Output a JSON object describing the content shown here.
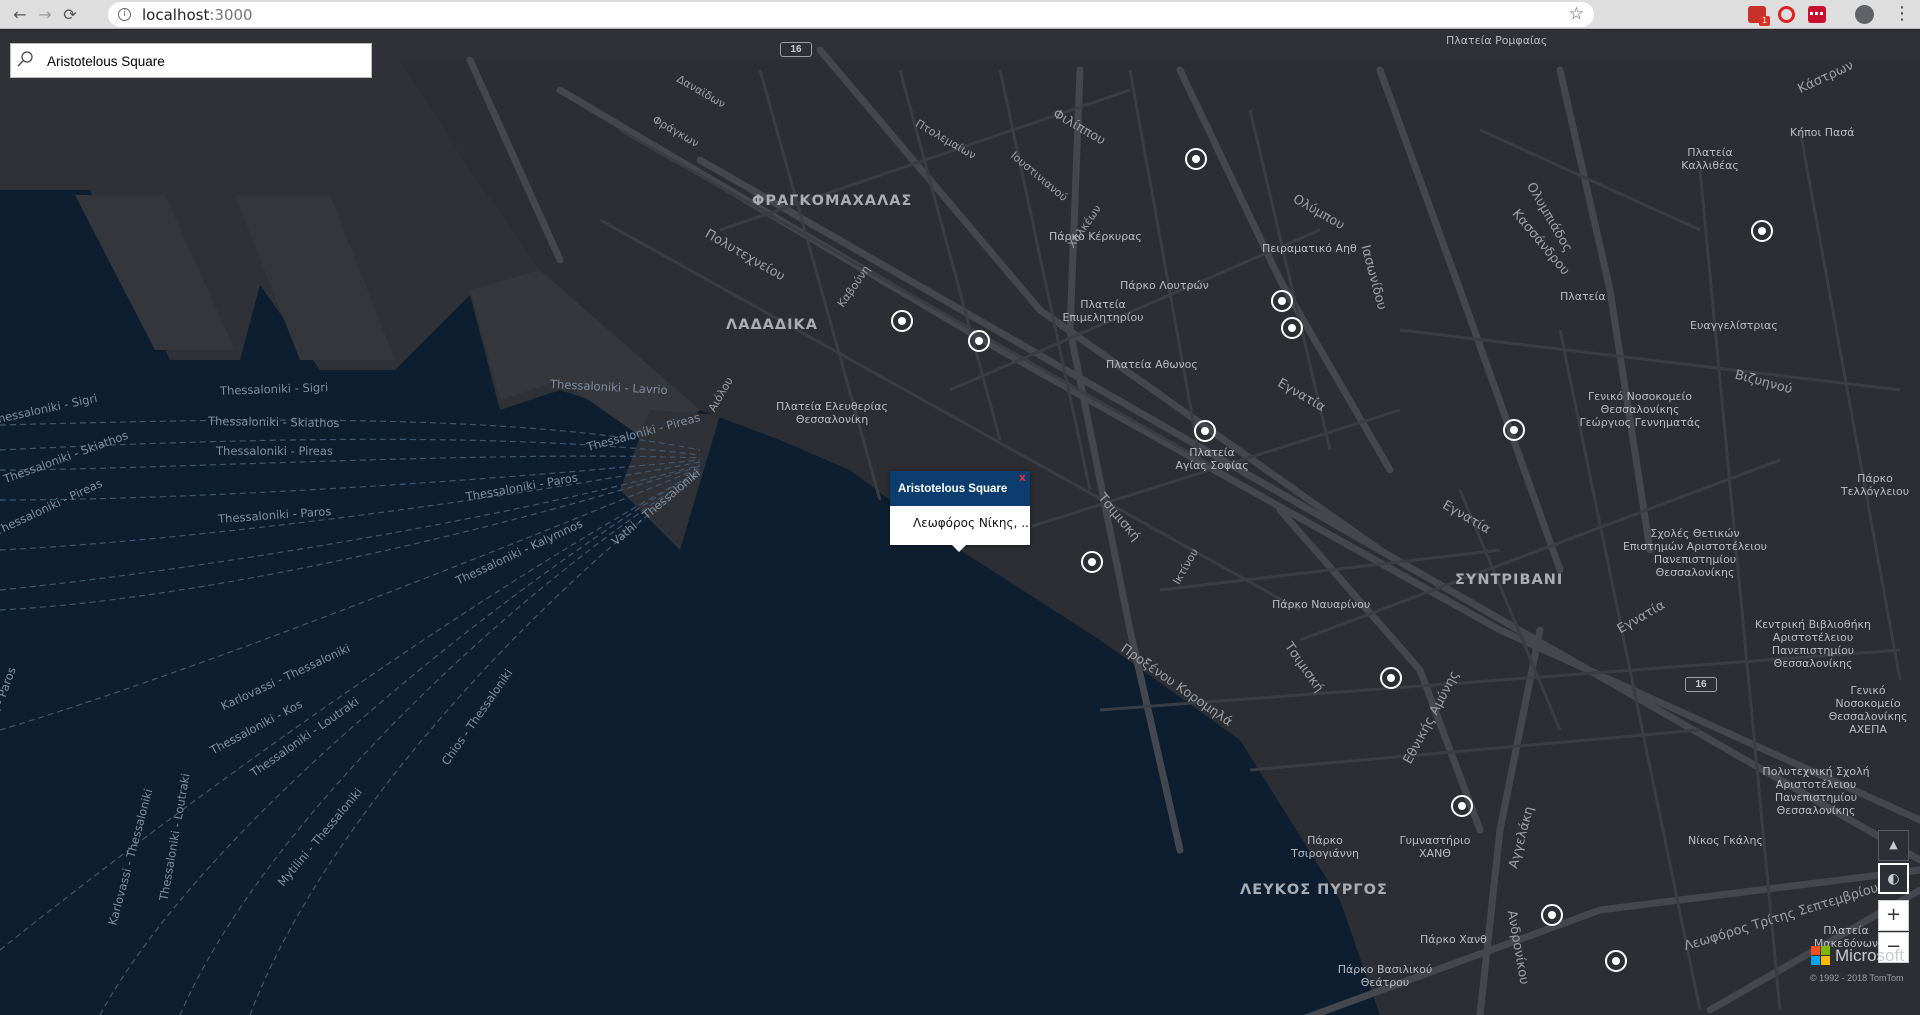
{
  "browser": {
    "url_host": "localhost",
    "url_port": ":3000",
    "mail_badge": "1",
    "back_icon": "←",
    "forward_icon": "→",
    "reload_icon": "⟳",
    "star_icon": "☆",
    "menu_icon": "⋮"
  },
  "search": {
    "value": "Aristotelous Square"
  },
  "popup": {
    "title": "Aristotelous Square",
    "close": "x",
    "address": "Λεωφόρος Νίκης, ..."
  },
  "districts": {
    "frangomachalas": "ΦΡΑΓΚΟΜΑΧΑΛΑΣ",
    "ladadika": "ΛΑΔΑΔΙΚΑ",
    "syntrivani": "ΣΥΝΤΡΙΒΑΝΙ",
    "lefkos_pyrgos": "ΛΕΥΚΟΣ ΠΥΡΓΟΣ"
  },
  "places": {
    "platia_romfeas": "Πλατεία Ρομφαίας",
    "kipoi_pasa": "Κήποι Πασά",
    "platia_kallitheas": "Πλατεία Καλλιθέας",
    "parko_kerkyras": "Πάρκο Κέρκυρας",
    "peiramatiko": "Πειραματικό Αηθ",
    "parko_loutron": "Πάρκο Λουτρών",
    "platia_epimelitiriou": "Πλατεία Επιμελητηρίου",
    "platia_athonos": "Πλατεία Αθωνος",
    "platia_eleftherias": "Πλατεία Ελευθερίας Θεσσαλονίκη",
    "platia_agias_sofias": "Πλατεία Αγίας Σοφίας",
    "platia": "Πλατεία",
    "evangelistria": "Ευαγγελίστριας",
    "geniko_nosokomeio": "Γενικό Νοσοκομείο Θεσσαλονίκης Γεώργιος Γεννηματάς",
    "parko_tellogleiou": "Πάρκο Τελλόγλειου",
    "scholes": "Σχολές Θετικών Επιστημών Αριστοτέλειου Πανεπιστημίου Θεσσαλονίκης",
    "parko_navarinou": "Πάρκο Ναυαρίνου",
    "kentriki_vivliothiki": "Κεντρική Βιβλιοθήκη Αριστοτέλειου Πανεπιστημίου Θεσσαλονίκης",
    "geniko_axepa": "Γενικό Νοσοκομείο Θεσσαλονίκης ΑΧΕΠΑ",
    "polytechniki": "Πολυτεχνική Σχολή Αριστοτέλειου Πανεπιστημίου Θεσσαλονίκης",
    "parko_tsirogianni": "Πάρκο Τσιρογιάννη",
    "gymnastirio_xanth": "Γυμναστήριο ΧΑΝΘ",
    "nikos_galis": "Νίκος Γκάλης",
    "platia_makedonon": "Πλατεία Μακεδόνων",
    "parko_xanth": "Πάρκο Χανθ",
    "parko_vasilikou": "Πάρκο Βασιλικού Θεάτρου"
  },
  "streets": {
    "politechneiou": "Πολυτεχνείου",
    "filippou": "Φιλίππου",
    "olympou": "Ολύμπου",
    "egnatia1": "Εγνατία",
    "egnatia2": "Εγνατία",
    "egnatia3": "Εγνατία",
    "tsimiski1": "Τσιμισκή",
    "tsimiski2": "Τσιμισκή",
    "olympiados": "Ολυμπιάδος",
    "kassandrou": "Κασσάνδρου",
    "vizyinou": "Βιζυηνού",
    "kastron": "Κάστρων",
    "iasonidou": "Ιασωνίδου",
    "proxenou": "Προξένου Κορομηλά",
    "ethnikis": "Εθνικής Αμύνης",
    "aggelaki": "Αγγελάκη",
    "andronikou": "Ανδρονίκου",
    "trites": "Λεωφόρος Τρίτης Σεπτεμβρίου",
    "ktinou": "Ικτίνου",
    "ptolemaion": "Πτολεμαίων",
    "ioustinianou": "Ιουστινιανού",
    "chalkeon": "Χαλκέων",
    "kavounis": "Καβούνη",
    "fragkon": "Φράγκων",
    "danaidon": "Δαναϊδων",
    "aiolou": "Αιόλου"
  },
  "ferries": {
    "sigri1": "Thessaloniki - Sigri",
    "sigri2": "Thessaloniki - Sigri",
    "lavrio": "Thessaloniki - Lavrio",
    "skiathos1": "Thessaloniki - Skiathos",
    "skiathos2": "Thessaloniki - Skiathos",
    "pireas1": "Thessaloniki - Pireas",
    "pireas2": "Thessaloniki - Pireas",
    "pireas3": "Thessaloniki - Pireas",
    "paros1": "Thessaloniki - Paros",
    "paros2": "Thessaloniki - Paros",
    "kalymnos": "Thessaloniki - Kalymnos",
    "vathi": "Vathi - Thessaloniki",
    "karlovassi1": "Karlovassi - Thessaloniki",
    "kos": "Thessaloniki - Kos",
    "loutraki": "Thessaloniki - Loutraki",
    "chios": "Chios - Thessaloniki",
    "mytilini": "Mytilini - Thessaloniki",
    "karlovassi2": "Karlovassi - Thessaloniki",
    "thess_loutraki": "Thessaloniki - Loutraki",
    "paros3": "niki - Paros"
  },
  "road_shield": "16",
  "controls": {
    "style_icon": "▲",
    "compass_icon": "◐",
    "zoom_in": "+",
    "zoom_out": "−"
  },
  "attribution": {
    "brand": "Microsoft",
    "copyright": "© 1992 - 2018 TomTom"
  }
}
